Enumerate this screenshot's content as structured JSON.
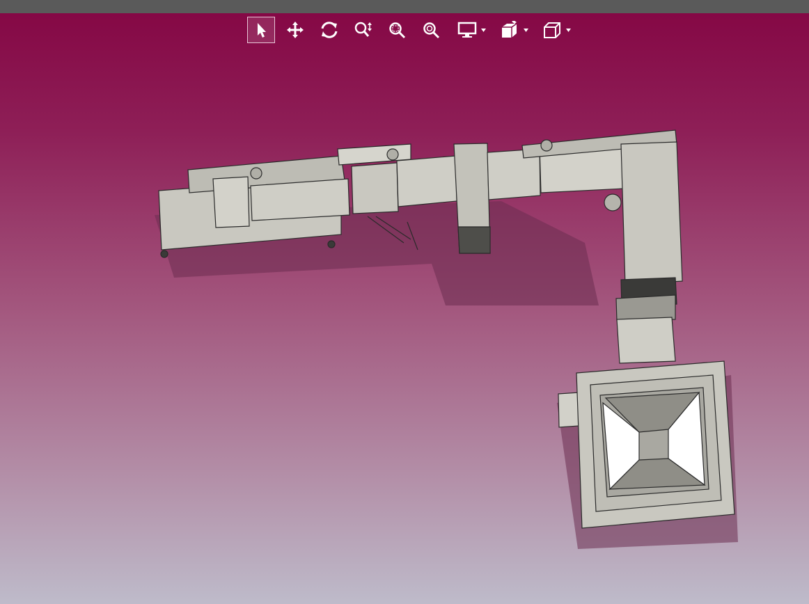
{
  "app": {
    "name": "3D CAD viewport"
  },
  "colors": {
    "topbar": "#5a5a5a",
    "viewport_top": "#850845",
    "viewport_bottom": "#bebbca",
    "model_fill": "#c9c8c0",
    "model_edge": "#2a2a2a",
    "shadow": "#5e2a47"
  },
  "toolbar": {
    "tools": [
      {
        "name": "select-tool",
        "icon": "arrow-pointer-icon",
        "active": true
      },
      {
        "name": "pan-tool",
        "icon": "move-cross-icon",
        "active": false
      },
      {
        "name": "rotate-tool",
        "icon": "rotate-icon",
        "active": false
      },
      {
        "name": "zoom-tool",
        "icon": "zoom-updown-icon",
        "active": false
      },
      {
        "name": "zoom-window-tool",
        "icon": "zoom-window-icon",
        "active": false
      },
      {
        "name": "zoom-fit-tool",
        "icon": "zoom-fit-icon",
        "active": false
      },
      {
        "name": "display-mode-dropdown",
        "icon": "monitor-icon",
        "active": false
      },
      {
        "name": "view-orientation-dropdown",
        "icon": "view-cube-icon",
        "active": false
      },
      {
        "name": "projection-dropdown",
        "icon": "box-icon",
        "active": false
      }
    ]
  }
}
